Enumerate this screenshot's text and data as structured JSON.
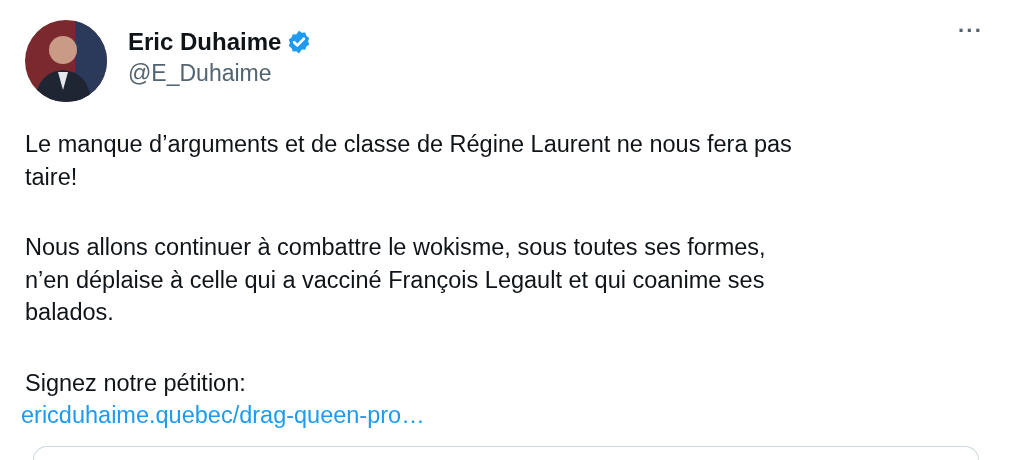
{
  "author": {
    "name": "Eric Duhaime",
    "verified": true,
    "handle": "@E_Duhaime"
  },
  "more_menu": {
    "label": "···"
  },
  "paragraphs": [
    [
      "Le manque d’arguments et de classe de Régine Laurent ne nous fera pas",
      "taire!"
    ],
    [
      "Nous allons continuer à combattre le wokisme, sous toutes ses formes,",
      "n’en déplaise à celle qui a vacciné François Legault et qui coanime ses",
      "balados."
    ],
    [
      "Signez notre pétition:"
    ]
  ],
  "link": "ericduhaime.quebec/drag-queen-pro…",
  "card": {
    "kind": "link-preview"
  }
}
